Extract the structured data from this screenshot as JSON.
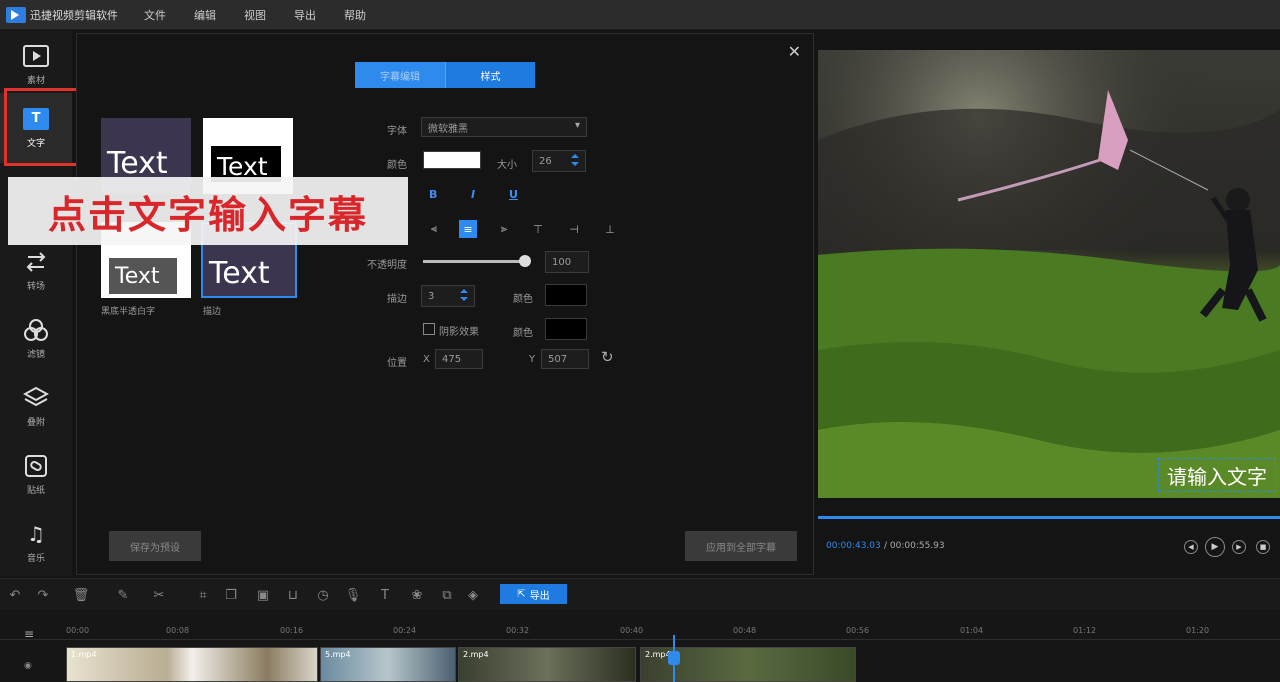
{
  "menubar": {
    "app_title": "迅捷视频剪辑软件",
    "items": [
      "文件",
      "编辑",
      "视图",
      "导出",
      "帮助"
    ]
  },
  "sidebar": {
    "items": [
      {
        "label": "素材",
        "icon": "play-media-icon"
      },
      {
        "label": "文字",
        "icon": "text-icon"
      },
      {
        "label": "转场",
        "icon": "transition-icon"
      },
      {
        "label": "滤镜",
        "icon": "filter-icon"
      },
      {
        "label": "叠附",
        "icon": "overlay-icon"
      },
      {
        "label": "贴纸",
        "icon": "sticker-icon"
      },
      {
        "label": "音乐",
        "icon": "music-icon"
      }
    ],
    "text_icon_glyph": "T"
  },
  "editor": {
    "tabs": [
      "字幕编辑",
      "样式"
    ],
    "presets": [
      {
        "sample": "Text",
        "label": ""
      },
      {
        "sample": "Text",
        "label": ""
      },
      {
        "sample": "Text",
        "label": "黑底半透白字"
      },
      {
        "sample": "Text",
        "label": "描边"
      }
    ],
    "form": {
      "font_label": "字体",
      "font_value": "微软雅黑",
      "color_label": "颜色",
      "size_label": "大小",
      "size_value": "26",
      "bold": "B",
      "italic": "I",
      "underline": "U",
      "opacity_label": "不透明度",
      "opacity_value": "100",
      "stroke_label": "描边",
      "stroke_value": "3",
      "stroke_color_label": "颜色",
      "shadow_label": "阴影效果",
      "shadow_color_label": "颜色",
      "position_label": "位置",
      "x_label": "X",
      "x_value": "475",
      "y_label": "Y",
      "y_value": "507"
    },
    "save_preset_label": "保存为预设",
    "apply_all_label": "应用到全部字幕"
  },
  "overlay_caption": "点击文字输入字幕",
  "preview": {
    "subtitle_placeholder": "请输入文字",
    "time_current": "00:00:43.03",
    "time_total": "/ 00:00:55.93"
  },
  "toolbar": {
    "export_label": "导出"
  },
  "timeline": {
    "ticks": [
      "00:00",
      "00:08",
      "00:16",
      "00:24",
      "00:32",
      "00:40",
      "00:48",
      "00:56",
      "01:04",
      "01:12",
      "01:20"
    ],
    "clips": [
      {
        "label": "1.mp4"
      },
      {
        "label": "5.mp4"
      },
      {
        "label": "2.mp4"
      },
      {
        "label": "2.mp4"
      }
    ]
  },
  "colors": {
    "accent": "#2f8aee",
    "highlight_red": "#e0312d",
    "text_color_swatch": "#ffffff",
    "stroke_color_swatch": "#000000",
    "shadow_color_swatch": "#000000"
  }
}
